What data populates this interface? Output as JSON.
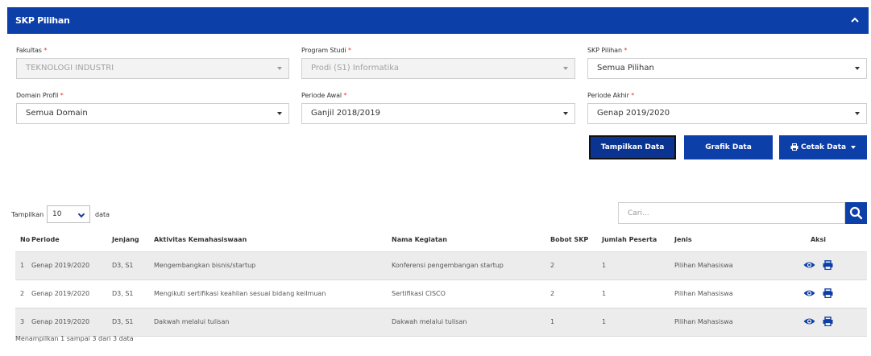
{
  "panel": {
    "title": "SKP Pilihan",
    "collapse_icon": "chevron-up-icon"
  },
  "filters": {
    "fakultas": {
      "label": "Fakultas",
      "value": "TEKNOLOGI INDUSTRI",
      "disabled": true
    },
    "program_studi": {
      "label": "Program Studi",
      "value": "Prodi (S1) Informatika",
      "disabled": true
    },
    "skp_pilihan": {
      "label": "SKP Pilihan",
      "value": "Semua Pilihan"
    },
    "domain_profil": {
      "label": "Domain Profil",
      "value": "Semua Domain"
    },
    "periode_awal": {
      "label": "Periode Awal",
      "value": "Ganjil 2018/2019"
    },
    "periode_akhir": {
      "label": "Periode Akhir",
      "value": "Genap 2019/2020"
    },
    "required_mark": "*"
  },
  "buttons": {
    "tampilkan": "Tampilkan Data",
    "grafik": "Grafik Data",
    "cetak": "Cetak Data"
  },
  "length_menu": {
    "prefix": "Tampilkan",
    "value": "10",
    "suffix": "data"
  },
  "search": {
    "placeholder": "Cari..."
  },
  "table": {
    "headers": [
      "No",
      "Periode",
      "Jenjang",
      "Aktivitas Kemahasiswaan",
      "Nama Kegiatan",
      "Bobot SKP",
      "Jumlah Peserta",
      "Jenis",
      "Aksi"
    ],
    "rows": [
      {
        "no": "1",
        "periode": "Genap 2019/2020",
        "jenjang": "D3, S1",
        "aktivitas": "Mengembangkan bisnis/startup",
        "kegiatan": "Konferensi pengembangan startup",
        "bobot": "2",
        "peserta": "1",
        "jenis": "Pilihan Mahasiswa"
      },
      {
        "no": "2",
        "periode": "Genap 2019/2020",
        "jenjang": "D3, S1",
        "aktivitas": "Mengikuti sertifikasi keahlian sesuai bidang keilmuan",
        "kegiatan": "Sertifikasi CISCO",
        "bobot": "2",
        "peserta": "1",
        "jenis": "Pilihan Mahasiswa"
      },
      {
        "no": "3",
        "periode": "Genap 2019/2020",
        "jenjang": "D3, S1",
        "aktivitas": "Dakwah melalui tulisan",
        "kegiatan": "Dakwah melalui tulisan",
        "bobot": "1",
        "peserta": "1",
        "jenis": "Pilihan Mahasiswa"
      }
    ]
  },
  "info": "Menampilkan 1 sampai 3 dari 3 data",
  "colors": {
    "primary": "#0d3fa8",
    "required": "#e53935",
    "row_alt": "#ececec"
  }
}
